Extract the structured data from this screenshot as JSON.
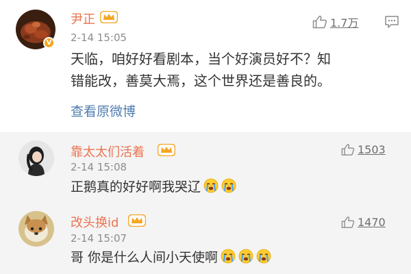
{
  "main_comment": {
    "username": "尹正",
    "timestamp": "2-14 15:05",
    "text_line1": "天临，咱好好看剧本，当个好演员好不？知",
    "text_line2": "错能改，善莫大焉，这个世界还是善良的。",
    "view_original_label": "查看原微博",
    "like_count": "1.7万",
    "verified_badge": "V",
    "icons": [
      "thumbs-up-icon",
      "comment-reply-icon",
      "vip-crown-icon",
      "verified-badge-icon"
    ]
  },
  "replies": [
    {
      "username": "靠太太们活着",
      "timestamp": "2-14 15:08",
      "text": "正鹅真的好好啊我哭辽",
      "emoji_count": 2,
      "emoji_name": "crying-emoji-icon",
      "like_count": "1503"
    },
    {
      "username": "改头换id",
      "timestamp": "2-14 15:07",
      "text": "哥 你是什么人间小天使啊",
      "emoji_count": 3,
      "emoji_name": "crying-emoji-icon",
      "like_count": "1470"
    }
  ],
  "colors": {
    "username": "#eb7350",
    "link": "#507daf",
    "timestamp": "#8c8c8c",
    "reply_background": "#f4f4f4",
    "crown": "#f5a623"
  }
}
